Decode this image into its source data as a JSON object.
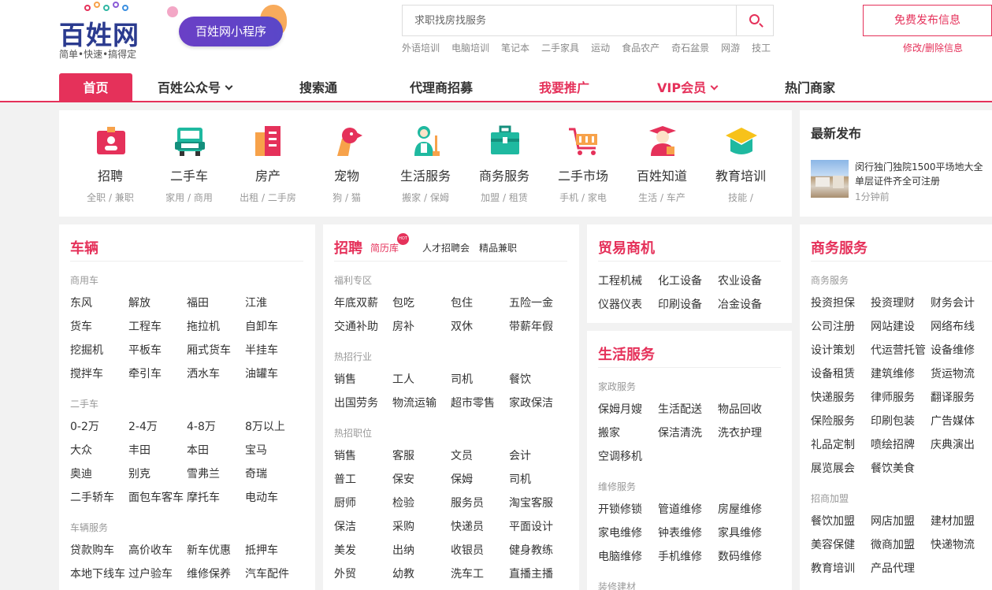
{
  "logo": {
    "name": "百姓网",
    "slogan": "简单•快速•搞得定"
  },
  "mini_program": "百姓网小程序",
  "search": {
    "placeholder": "求职找房找服务",
    "hotwords": [
      "外语培训",
      "电脑培训",
      "笔记本",
      "二手家具",
      "运动",
      "食品农产",
      "奇石盆景",
      "网游",
      "技工"
    ]
  },
  "publish": {
    "label": "免费发布信息",
    "modify": "修改/删除信息"
  },
  "nav": {
    "home": "首页",
    "public_account": "百姓公众号",
    "search_pass": "搜索通",
    "agent": "代理商招募",
    "promote": "我要推广",
    "vip": "VIP会员",
    "hot_merchants": "热门商家"
  },
  "categories": [
    {
      "icon": "recruit-icon",
      "label": "招聘",
      "sub": "全职 / 兼职"
    },
    {
      "icon": "used-car-icon",
      "label": "二手车",
      "sub": "家用 / 商用"
    },
    {
      "icon": "house-icon",
      "label": "房产",
      "sub": "出租 / 二手房"
    },
    {
      "icon": "pet-icon",
      "label": "宠物",
      "sub": "狗 / 猫"
    },
    {
      "icon": "life-service-icon",
      "label": "生活服务",
      "sub": "搬家 / 保姆"
    },
    {
      "icon": "business-icon",
      "label": "商务服务",
      "sub": "加盟 / 租赁"
    },
    {
      "icon": "shopping-cart-icon",
      "label": "二手市场",
      "sub": "手机 / 家电"
    },
    {
      "icon": "knowledge-icon",
      "label": "百姓知道",
      "sub": "生活 / 车产"
    },
    {
      "icon": "education-icon",
      "label": "教育培训",
      "sub": "技能 /"
    }
  ],
  "latest": {
    "title": "最新发布",
    "item_text": "闵行独门独院1500平场地大全单层证件齐全可注册",
    "item_time": "1分钟前"
  },
  "vehicles": {
    "title": "车辆",
    "sections": [
      {
        "name": "商用车",
        "rows": [
          [
            "东风",
            "解放",
            "福田",
            "江淮"
          ],
          [
            "货车",
            "工程车",
            "拖拉机",
            "自卸车"
          ],
          [
            "挖掘机",
            "平板车",
            "厢式货车",
            "半挂车"
          ],
          [
            "搅拌车",
            "牵引车",
            "洒水车",
            "油罐车"
          ]
        ]
      },
      {
        "name": "二手车",
        "rows": [
          [
            "0-2万",
            "2-4万",
            "4-8万",
            "8万以上"
          ],
          [
            "大众",
            "丰田",
            "本田",
            "宝马"
          ],
          [
            "奥迪",
            "别克",
            "雪弗兰",
            "奇瑞"
          ],
          [
            "二手轿车",
            "面包车客车",
            "摩托车",
            "电动车"
          ]
        ]
      },
      {
        "name": "车辆服务",
        "rows": [
          [
            "贷款购车",
            "高价收车",
            "新车优惠",
            "抵押车"
          ],
          [
            "本地下线车",
            "过户验车",
            "维修保养",
            "汽车配件"
          ]
        ]
      }
    ]
  },
  "recruit": {
    "title": "招聘",
    "tabs": [
      "简历库",
      "人才招聘会",
      "精品兼职"
    ],
    "hot_badge": "HOT",
    "sections": [
      {
        "name": "福利专区",
        "rows": [
          [
            "年底双薪",
            "包吃",
            "包住",
            "五险一金"
          ],
          [
            "交通补助",
            "房补",
            "双休",
            "带薪年假"
          ]
        ]
      },
      {
        "name": "热招行业",
        "rows": [
          [
            "销售",
            "工人",
            "司机",
            "餐饮"
          ],
          [
            "出国劳务",
            "物流运输",
            "超市零售",
            "家政保洁"
          ]
        ]
      },
      {
        "name": "热招职位",
        "rows": [
          [
            "销售",
            "客服",
            "文员",
            "会计"
          ],
          [
            "普工",
            "保安",
            "保姆",
            "司机"
          ],
          [
            "厨师",
            "检验",
            "服务员",
            "淘宝客服"
          ],
          [
            "保洁",
            "采购",
            "快递员",
            "平面设计"
          ],
          [
            "美发",
            "出纳",
            "收银员",
            "健身教练"
          ],
          [
            "外贸",
            "幼教",
            "洗车工",
            "直播主播"
          ]
        ]
      }
    ]
  },
  "trade": {
    "title": "贸易商机",
    "rows": [
      [
        "工程机械",
        "化工设备",
        "农业设备"
      ],
      [
        "仪器仪表",
        "印刷设备",
        "冶金设备"
      ]
    ]
  },
  "life": {
    "title": "生活服务",
    "sections": [
      {
        "name": "家政服务",
        "rows": [
          [
            "保姆月嫂",
            "生活配送",
            "物品回收"
          ],
          [
            "搬家",
            "保洁清洗",
            "洗衣护理"
          ],
          [
            "空调移机"
          ]
        ]
      },
      {
        "name": "维修服务",
        "rows": [
          [
            "开锁修锁",
            "管道维修",
            "房屋维修"
          ],
          [
            "家电维修",
            "钟表维修",
            "家具维修"
          ],
          [
            "电脑维修",
            "手机维修",
            "数码维修"
          ]
        ]
      },
      {
        "name": "装修建材",
        "rows": []
      }
    ]
  },
  "business": {
    "title": "商务服务",
    "sections": [
      {
        "name": "商务服务",
        "rows": [
          [
            "投资担保",
            "投资理财",
            "财务会计"
          ],
          [
            "公司注册",
            "网站建设",
            "网络布线"
          ],
          [
            "设计策划",
            "代运营托管",
            "设备维修"
          ],
          [
            "设备租赁",
            "建筑维修",
            "货运物流"
          ],
          [
            "快递服务",
            "律师服务",
            "翻译服务"
          ],
          [
            "保险服务",
            "印刷包装",
            "广告媒体"
          ],
          [
            "礼品定制",
            "喷绘招牌",
            "庆典演出"
          ],
          [
            "展览展会",
            "餐饮美食"
          ]
        ]
      },
      {
        "name": "招商加盟",
        "rows": [
          [
            "餐饮加盟",
            "网店加盟",
            "建材加盟"
          ],
          [
            "美容保健",
            "微商加盟",
            "快递物流"
          ],
          [
            "教育培训",
            "产品代理"
          ]
        ]
      }
    ]
  }
}
